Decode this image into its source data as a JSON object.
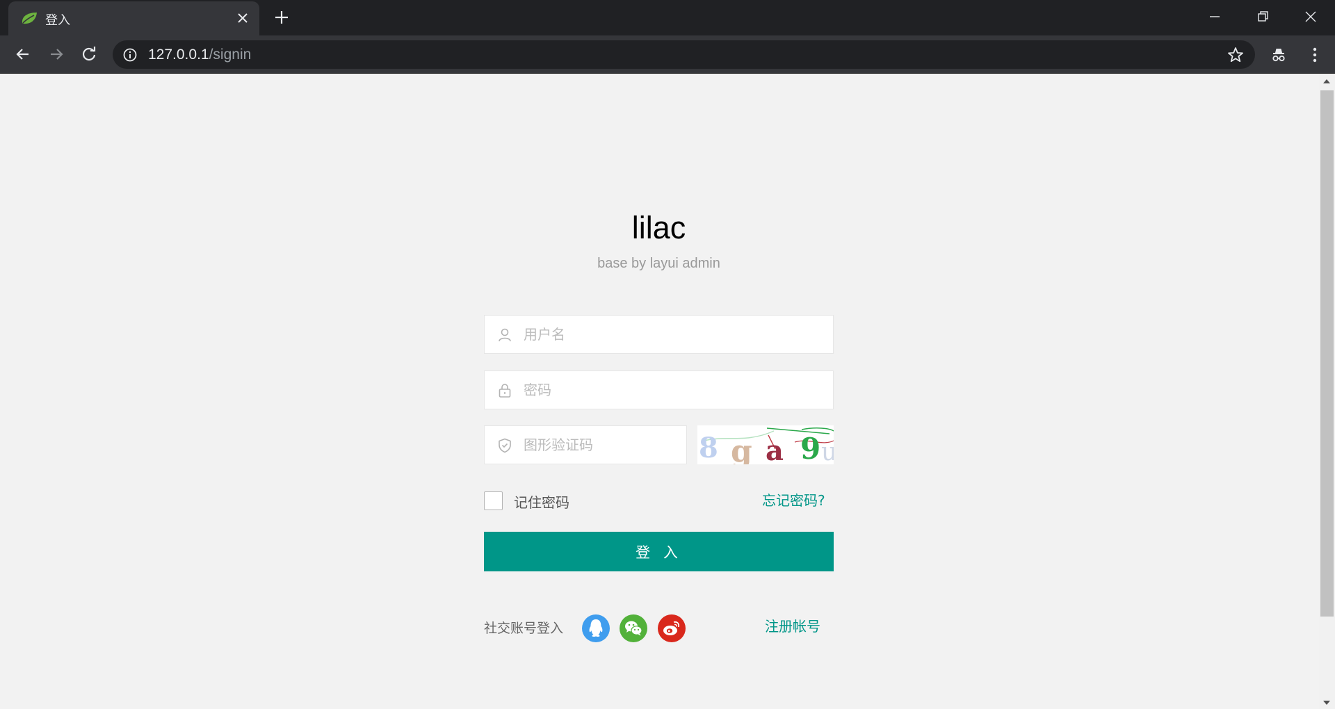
{
  "browser": {
    "tab_title": "登入",
    "url_host": "127.0.0.1",
    "url_path": "/signin"
  },
  "login": {
    "title": "lilac",
    "subtitle": "base by layui admin",
    "username_placeholder": "用户名",
    "password_placeholder": "密码",
    "captcha_placeholder": "图形验证码",
    "captcha_text": "8ga9",
    "remember_label": "记住密码",
    "remember_checked": false,
    "forgot_label": "忘记密码?",
    "submit_label": "登 入",
    "social_label": "社交账号登入",
    "social_providers": [
      "qq-icon",
      "wechat-icon",
      "weibo-icon"
    ],
    "register_label": "注册帐号"
  },
  "colors": {
    "accent": "#009688",
    "page_bg": "#f2f2f2",
    "qq": "#3f9dee",
    "wechat": "#52b13a",
    "weibo": "#d9281c"
  }
}
